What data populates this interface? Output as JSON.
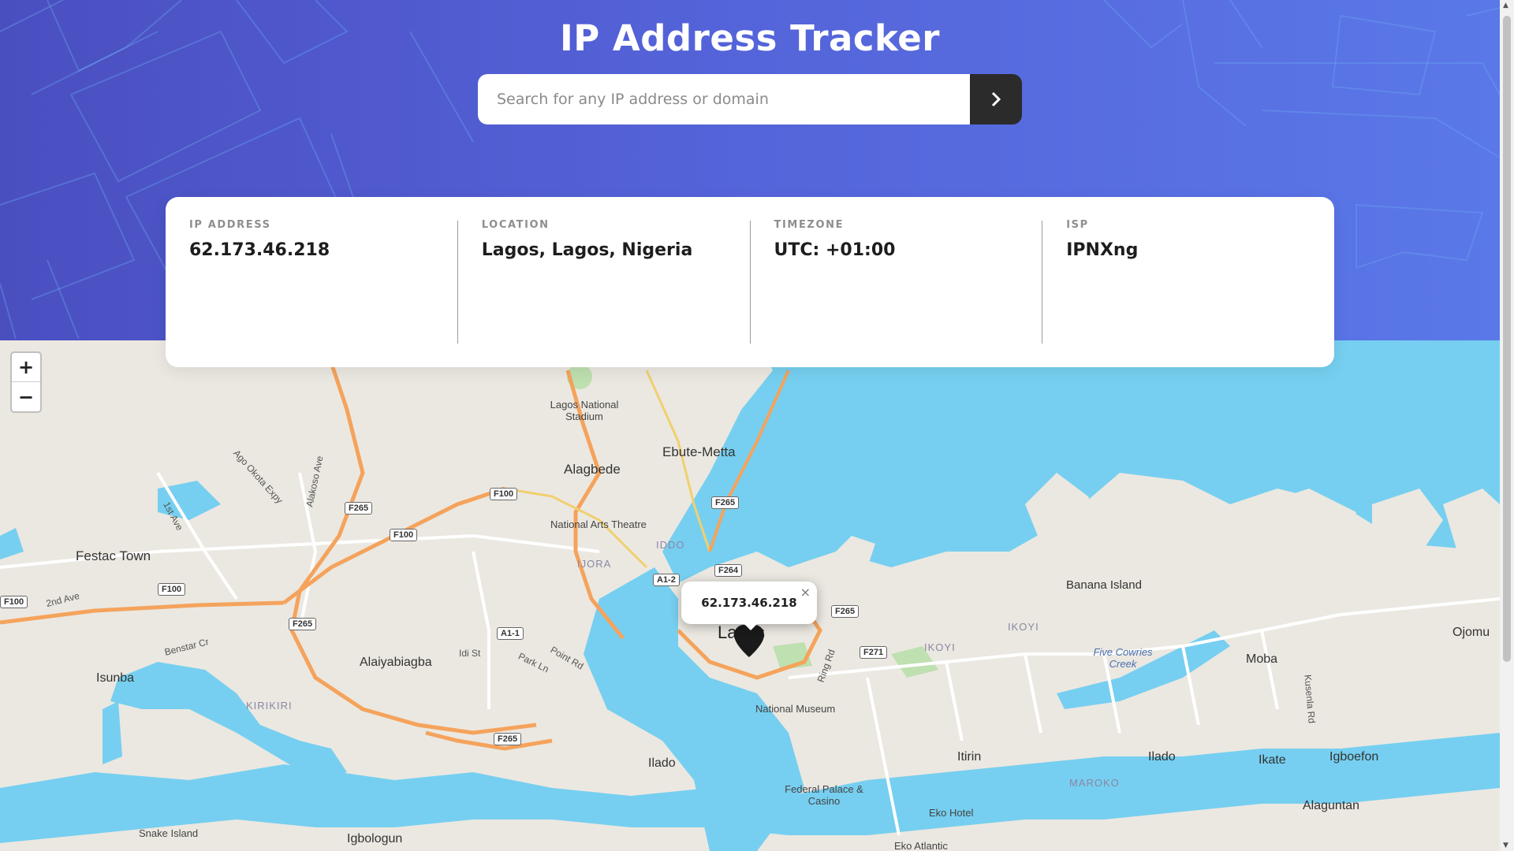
{
  "header": {
    "title": "IP Address Tracker",
    "search_placeholder": "Search for any IP address or domain",
    "submit_icon": "chevron-right-icon"
  },
  "info": {
    "ip": {
      "label": "IP ADDRESS",
      "value": "62.173.46.218"
    },
    "location": {
      "label": "LOCATION",
      "value": "Lagos, Lagos, Nigeria"
    },
    "timezone": {
      "label": "TIMEZONE",
      "value": "UTC: +01:00"
    },
    "isp": {
      "label": "ISP",
      "value": "IPNXng"
    }
  },
  "map": {
    "zoom_in": "+",
    "zoom_out": "−",
    "popup_text": "62.173.46.218",
    "popup_close": "×",
    "places": {
      "lagos_national_stadium": "Lagos National Stadium",
      "ebute_metta": "Ebute-Metta",
      "alagbede": "Alagbede",
      "festac_town": "Festac Town",
      "national_arts_theatre": "National Arts Theatre",
      "iddo": "IDDO",
      "ijora": "IJORA",
      "banana_island": "Banana Island",
      "ikoyi": "IKOYI",
      "ikoyi2": "IKOYI",
      "lagos": "Lagos",
      "alaiyabiagba": "Alaiyabiagba",
      "isunba": "Isunba",
      "kirikiri": "KIRIKIRI",
      "national_museum": "National Museum",
      "moba": "Moba",
      "ojomu": "Ojomu",
      "itirin": "Itirin",
      "ilado": "Ilado",
      "ilado2": "Ilado",
      "ikate": "Ikate",
      "igboefon": "Igboefon",
      "maroko": "MAROKO",
      "alaguntan": "Alaguntan",
      "federal_palace": "Federal Palace & Casino",
      "eko_hotel": "Eko Hotel",
      "snake_island": "Snake Island",
      "igbologun": "Igbologun",
      "five_cowries": "Five Cowries Creek",
      "eko_atlantic": "Eko Atlantic"
    },
    "roads": {
      "ago_okota": "Ago Okota Expy",
      "alakoso": "Alakoso Ave",
      "first_ave": "1st Ave",
      "second_ave": "2nd Ave",
      "benstar": "Benstar Cr",
      "idi_st": "Idi St",
      "park_ln": "Park Ln",
      "point_rd": "Point Rd",
      "ring_rd": "Ring Rd",
      "kusenla": "Kusenla Rd"
    },
    "shields": {
      "f265a": "F265",
      "f100a": "F100",
      "f100b": "F100",
      "f100c": "F100",
      "f100d": "F100",
      "f265b": "F265",
      "f265c": "F265",
      "f265d": "F265",
      "f264": "F264",
      "a12": "A1-2",
      "a11": "A1-1",
      "f265e": "F265",
      "f271": "F271",
      "f265f": "F265"
    }
  }
}
